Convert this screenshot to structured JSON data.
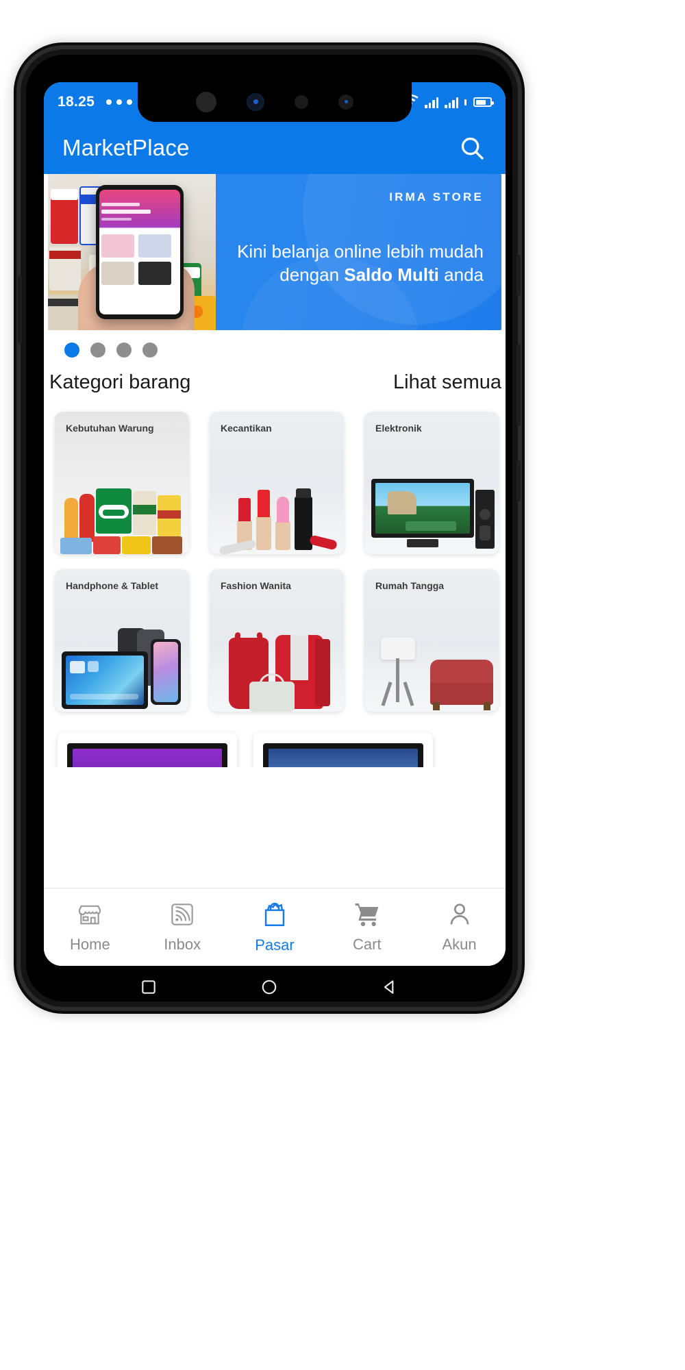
{
  "status_bar": {
    "time": "18.25",
    "dots_icon": "more-dots-icon",
    "wifi_icon": "wifi-icon",
    "signal_icon": "signal-bars-icon",
    "signal2_icon": "signal-bars-icon",
    "battery_icon": "battery-icon"
  },
  "app_bar": {
    "title": "MarketPlace",
    "search_icon": "search-icon"
  },
  "banner": {
    "store_name": "IRMA STORE",
    "line1": "Kini belanja online lebih mudah",
    "line2_pre": "dengan ",
    "line2_strong": "Saldo Multi",
    "line2_post": " anda"
  },
  "carousel": {
    "dots": 4,
    "active_index": 0,
    "active_color": "#0b7ae8",
    "inactive_color": "#8e8e8e"
  },
  "section": {
    "title": "Kategori barang",
    "see_all": "Lihat semua"
  },
  "categories": [
    {
      "label": "Kebutuhan Warung",
      "art": "grocery"
    },
    {
      "label": "Kecantikan",
      "art": "cosmetics"
    },
    {
      "label": "Elektronik",
      "art": "tv"
    },
    {
      "label": "Handphone & Tablet",
      "art": "phones"
    },
    {
      "label": "Fashion Wanita",
      "art": "fashion"
    },
    {
      "label": "Rumah Tangga",
      "art": "furniture"
    }
  ],
  "products": [
    {
      "art": "monitor-purple"
    },
    {
      "art": "monitor-sky"
    }
  ],
  "bottom_nav": [
    {
      "label": "Home",
      "icon": "store-icon",
      "active": false
    },
    {
      "label": "Inbox",
      "icon": "inbox-waves-icon",
      "active": false
    },
    {
      "label": "Pasar",
      "icon": "shopping-bag-icon",
      "active": true
    },
    {
      "label": "Cart",
      "icon": "shopping-cart-icon",
      "active": false
    },
    {
      "label": "Akun",
      "icon": "person-icon",
      "active": false
    }
  ],
  "android_nav": {
    "recent_icon": "square-recents-icon",
    "home_icon": "circle-home-icon",
    "back_icon": "triangle-back-icon"
  },
  "colors": {
    "brand_blue": "#0b7ae8",
    "accent_blue": "#1579e8",
    "nav_gray": "#8a8a8a"
  }
}
